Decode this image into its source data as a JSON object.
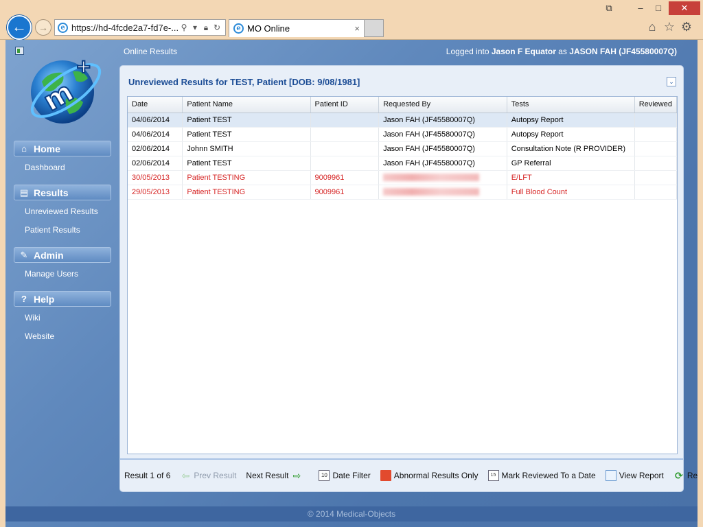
{
  "browser": {
    "address": "https://hd-4fcde2a7-fd7e-...",
    "tab_title": "MO Online",
    "tab_close": "×",
    "window_controls": [
      "restore-down",
      "minimize",
      "maximize",
      "close"
    ]
  },
  "header": {
    "section_title": "Online Results",
    "logged_prefix": "Logged into",
    "logged_org": "Jason F Equator",
    "logged_as": "as",
    "logged_user": "JASON FAH (JF45580007Q)"
  },
  "sidebar": {
    "sections": [
      {
        "title": "Home",
        "icon": "house-icon",
        "items": [
          "Dashboard"
        ]
      },
      {
        "title": "Results",
        "icon": "results-icon",
        "items": [
          "Unreviewed Results",
          "Patient Results"
        ]
      },
      {
        "title": "Admin",
        "icon": "admin-icon",
        "items": [
          "Manage Users"
        ]
      },
      {
        "title": "Help",
        "icon": "help-icon",
        "items": [
          "Wiki",
          "Website"
        ]
      }
    ]
  },
  "panel": {
    "title": "Unreviewed Results for TEST, Patient [DOB: 9/08/1981]",
    "columns": [
      "Date",
      "Patient Name",
      "Patient ID",
      "Requested By",
      "Tests",
      "Reviewed"
    ],
    "rows": [
      {
        "date": "04/06/2014",
        "name": "Patient TEST",
        "pid": "",
        "requested": "Jason FAH (JF45580007Q)",
        "test": "Autopsy Report",
        "reviewed": ""
      },
      {
        "date": "04/06/2014",
        "name": "Patient TEST",
        "pid": "",
        "requested": "Jason FAH (JF45580007Q)",
        "test": "Autopsy Report",
        "reviewed": ""
      },
      {
        "date": "02/06/2014",
        "name": "Johnn SMITH",
        "pid": "",
        "requested": "Jason FAH (JF45580007Q)",
        "test": "Consultation Note (R PROVIDER)",
        "reviewed": ""
      },
      {
        "date": "02/06/2014",
        "name": "Patient TEST",
        "pid": "",
        "requested": "Jason FAH (JF45580007Q)",
        "test": "GP Referral",
        "reviewed": ""
      },
      {
        "date": "30/05/2013",
        "name": "Patient TESTING",
        "pid": "9009961",
        "requested": "",
        "test": "E/LFT",
        "reviewed": ""
      },
      {
        "date": "29/05/2013",
        "name": "Patient TESTING",
        "pid": "9009961",
        "requested": "",
        "test": "Full Blood Count",
        "reviewed": ""
      }
    ],
    "abnormal_color": "#d62424"
  },
  "toolbar": {
    "result_count": "Result 1 of 6",
    "prev": "Prev Result",
    "next": "Next Result",
    "date_filter": "Date Filter",
    "abnormal_only": "Abnormal Results Only",
    "mark_reviewed": "Mark Reviewed To a Date",
    "view_report": "View Report",
    "refresh": "Refresh"
  },
  "footer": {
    "text": "© 2014 Medical-Objects"
  }
}
